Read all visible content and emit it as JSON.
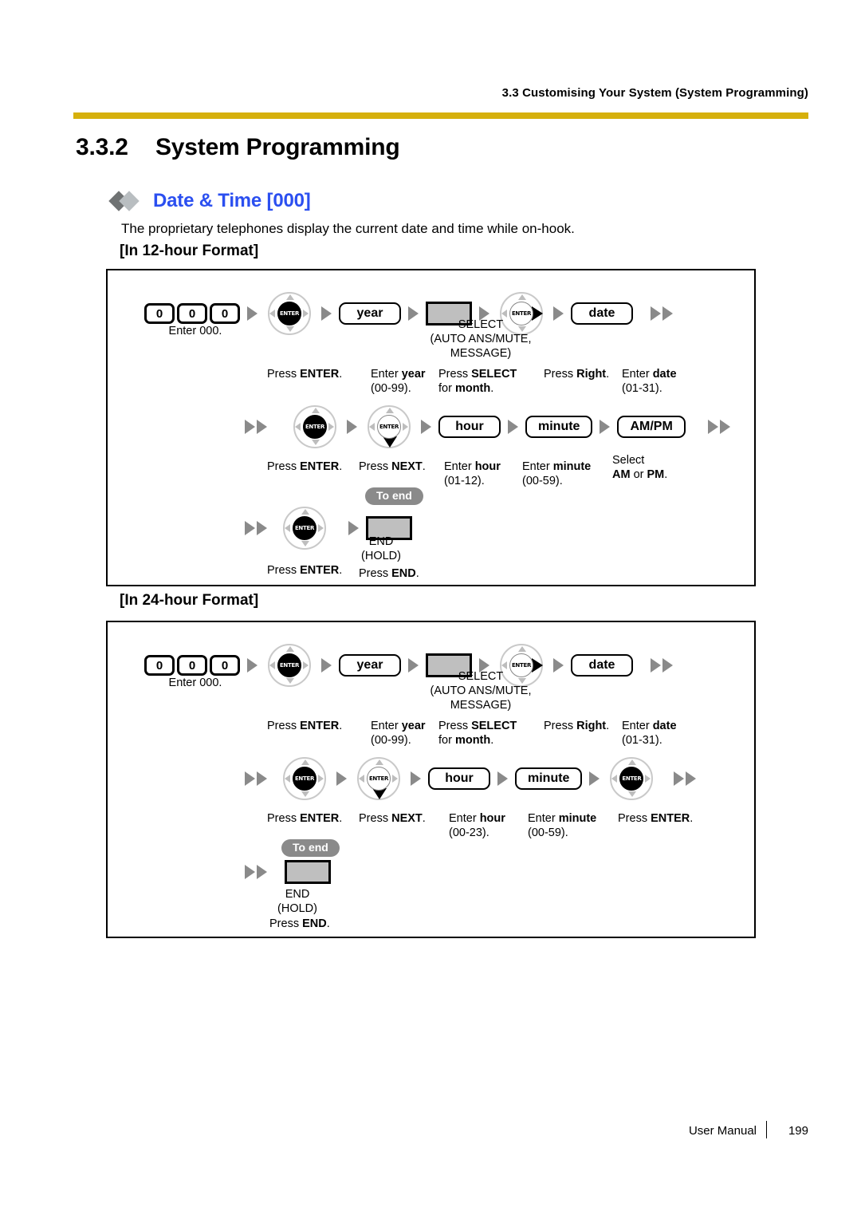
{
  "header": {
    "running_head": "3.3 Customising Your System (System Programming)",
    "rule_color": "#d6b00c"
  },
  "section": {
    "number": "3.3.2",
    "title": "System Programming"
  },
  "feature": {
    "title": "Date & Time [000]",
    "title_color": "#2b4ff0",
    "description": "The proprietary telephones display the current date and time while on-hook."
  },
  "labels": {
    "format_12": "[In 12-hour Format]",
    "format_24": "[In 24-hour Format]",
    "to_end": "To end"
  },
  "keys": {
    "digit": "0",
    "enter_center": "ENTER",
    "pill_year": "year",
    "pill_date": "date",
    "pill_hour": "hour",
    "pill_minute": "minute",
    "pill_ampm": "AM/PM"
  },
  "flow12": {
    "row1": {
      "enter_000": "Enter 000.",
      "select_line1": "SELECT",
      "select_line2": "(AUTO ANS/MUTE,",
      "select_line3": "MESSAGE)",
      "cap_enter": "Press ENTER.",
      "cap_year_1": "Enter year",
      "cap_year_2": "(00-99).",
      "cap_select_1": "Press SELECT",
      "cap_select_2": "for month.",
      "cap_right": "Press Right.",
      "cap_date_1": "Enter date",
      "cap_date_2": "(01-31)."
    },
    "row2": {
      "cap_enter": "Press ENTER.",
      "cap_next": "Press NEXT.",
      "cap_hour_1": "Enter hour",
      "cap_hour_2": "(01-12).",
      "cap_minute_1": "Enter minute",
      "cap_minute_2": "(00-59).",
      "cap_ampm_1": "Select",
      "cap_ampm_2": "AM or PM."
    },
    "row3": {
      "cap_enter": "Press ENTER.",
      "end_line1": "END",
      "end_line2": "(HOLD)",
      "cap_end": "Press END."
    }
  },
  "flow24": {
    "row1": {
      "enter_000": "Enter 000.",
      "select_line1": "SELECT",
      "select_line2": "(AUTO ANS/MUTE,",
      "select_line3": "MESSAGE)",
      "cap_enter": "Press ENTER.",
      "cap_year_1": "Enter year",
      "cap_year_2": "(00-99).",
      "cap_select_1": "Press SELECT",
      "cap_select_2": "for month.",
      "cap_right": "Press Right.",
      "cap_date_1": "Enter date",
      "cap_date_2": "(01-31)."
    },
    "row2": {
      "cap_enter": "Press ENTER.",
      "cap_next": "Press NEXT.",
      "cap_hour_1": "Enter hour",
      "cap_hour_2": "(00-23).",
      "cap_minute_1": "Enter minute",
      "cap_minute_2": "(00-59).",
      "cap_enter2": "Press ENTER."
    },
    "row3": {
      "end_line1": "END",
      "end_line2": "(HOLD)",
      "cap_end": "Press END."
    }
  },
  "footer": {
    "manual": "User Manual",
    "page": "199"
  }
}
